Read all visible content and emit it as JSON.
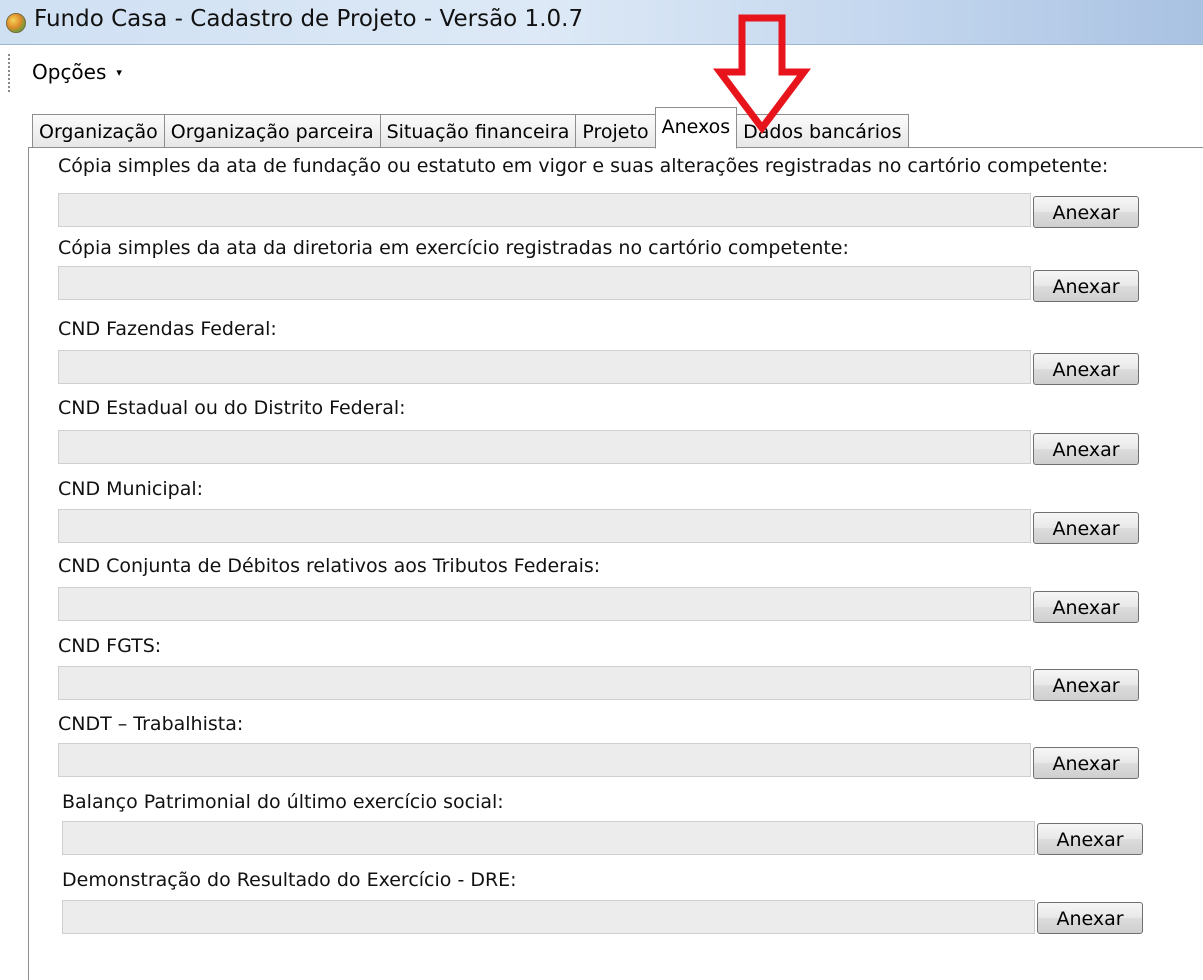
{
  "window": {
    "title": "Fundo Casa - Cadastro de Projeto - Versão 1.0.7"
  },
  "menu": {
    "opcoes": "Opções",
    "caret": "▾"
  },
  "tabs": [
    {
      "label": "Organização"
    },
    {
      "label": "Organização parceira"
    },
    {
      "label": "Situação financeira"
    },
    {
      "label": "Projeto"
    },
    {
      "label": "Anexos"
    },
    {
      "label": "Dados bancários"
    }
  ],
  "active_tab": "Anexos",
  "annotation": {
    "icon": "red-down-arrow-icon",
    "color": "#e8141b"
  },
  "attachments": [
    {
      "label": "Cópia  simples da ata de fundação ou estatuto em vigor e suas alterações registradas no cartório competente:",
      "value": "",
      "button": "Anexar"
    },
    {
      "label": "Cópia simples  da ata da diretoria em exercício registradas no cartório competente:",
      "value": "",
      "button": "Anexar"
    },
    {
      "label": "CND Fazendas Federal:",
      "value": "",
      "button": "Anexar"
    },
    {
      "label": "CND Estadual ou do Distrito Federal:",
      "value": "",
      "button": "Anexar"
    },
    {
      "label": "CND Municipal:",
      "value": "",
      "button": "Anexar"
    },
    {
      "label": "CND Conjunta de Débitos relativos aos Tributos Federais:",
      "value": "",
      "button": "Anexar"
    },
    {
      "label": "CND  FGTS:",
      "value": "",
      "button": "Anexar"
    },
    {
      "label": "CNDT – Trabalhista:",
      "value": "",
      "button": "Anexar"
    },
    {
      "label": "Balanço Patrimonial do último exercício social:",
      "value": "",
      "button": "Anexar"
    },
    {
      "label": "Demonstração do Resultado do Exercício - DRE:",
      "value": "",
      "button": "Anexar"
    }
  ]
}
